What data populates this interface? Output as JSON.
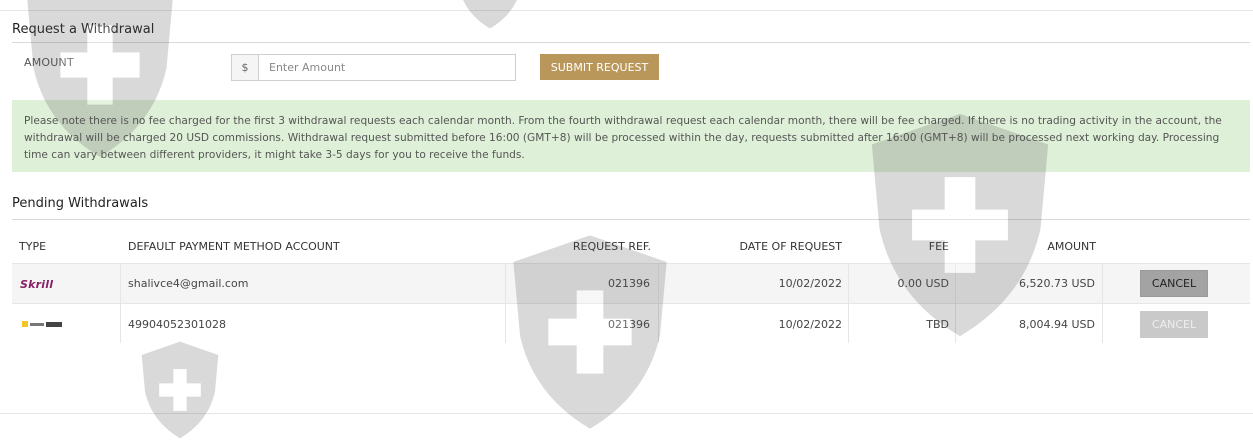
{
  "request_section": {
    "title": "Request a Withdrawal",
    "amount_label": "AMOUNT",
    "currency_symbol": "$",
    "amount_placeholder": "Enter Amount",
    "amount_value": "",
    "submit_label": "SUBMIT REQUEST"
  },
  "notice_text": "Please note there is no fee charged for the first 3 withdrawal requests each calendar month. From the fourth withdrawal request each calendar month, there will be fee charged. If there is no trading activity in the account, the withdrawal will be charged 20 USD commissions. Withdrawal request submitted before 16:00 (GMT+8) will be processed within the day, requests submitted after 16:00 (GMT+8) will be processed next working day. Processing time can vary between different providers, it might take 3-5 days for you to receive the funds.",
  "pending_section": {
    "title": "Pending Withdrawals",
    "columns": {
      "type": "TYPE",
      "account": "DEFAULT PAYMENT METHOD ACCOUNT",
      "ref": "REQUEST REF.",
      "date": "DATE OF REQUEST",
      "fee": "FEE",
      "amount": "AMOUNT"
    },
    "rows": [
      {
        "type_logo": "Skrill",
        "account": "shalivce4@gmail.com",
        "ref": "021396",
        "date": "10/02/2022",
        "fee": "0.00 USD",
        "amount": "6,520.73 USD",
        "action": "CANCEL",
        "action_enabled": true
      },
      {
        "type_logo": "bank-wire-logo",
        "account": "49904052301028",
        "ref": "021396",
        "date": "10/02/2022",
        "fee": "TBD",
        "amount": "8,004.94 USD",
        "action": "CANCEL",
        "action_enabled": false
      }
    ]
  },
  "colors": {
    "accent": "#b9975b",
    "notice_bg": "#dff0d8",
    "skrill": "#862165"
  }
}
